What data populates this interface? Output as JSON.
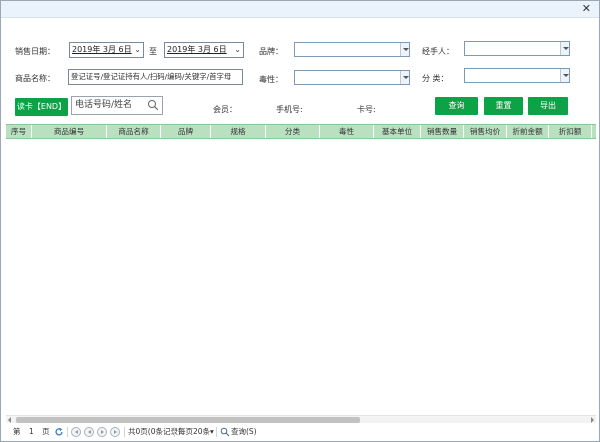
{
  "window": {
    "close_glyph": "✕"
  },
  "filters": {
    "sales_date_label": "销售日期：",
    "date_from": {
      "value": "2019年  3月  6日",
      "dropdown": "⌄"
    },
    "to_label": "至",
    "date_to": {
      "value": "2019年  3月  6日",
      "dropdown": "⌄"
    },
    "brand_label": "品牌：",
    "handler_label": "经手人：",
    "product_name_label": "商品名称：",
    "product_name_value": "登记证号/登记证持有人/扫码/编码/关键字/首字母",
    "toxicity_label": "毒性：",
    "category_label": "分 类："
  },
  "member_bar": {
    "read_card_label": "读卡【END】",
    "phone_placeholder": "电话号码/姓名",
    "member_label": "会员：",
    "mobile_label": "手机号:",
    "card_label": "卡号:",
    "query_label": "查询",
    "reset_label": "重置",
    "export_label": "导出"
  },
  "table": {
    "columns": [
      "序号",
      "商品编号",
      "商品名称",
      "品牌",
      "规格",
      "分类",
      "毒性",
      "基本单位",
      "销售数量",
      "销售均价",
      "折前金额",
      "折扣额"
    ]
  },
  "pager": {
    "page_prefix": "第",
    "page_value": "1",
    "page_suffix": "页",
    "total_text": "共0页(0条记录)",
    "per_page": "每页20条▾",
    "query_text": "查询(S)"
  },
  "colors": {
    "accent_green": "#0da246",
    "header_green": "#b9e0bf",
    "titlebar": "#eaf3fb"
  }
}
